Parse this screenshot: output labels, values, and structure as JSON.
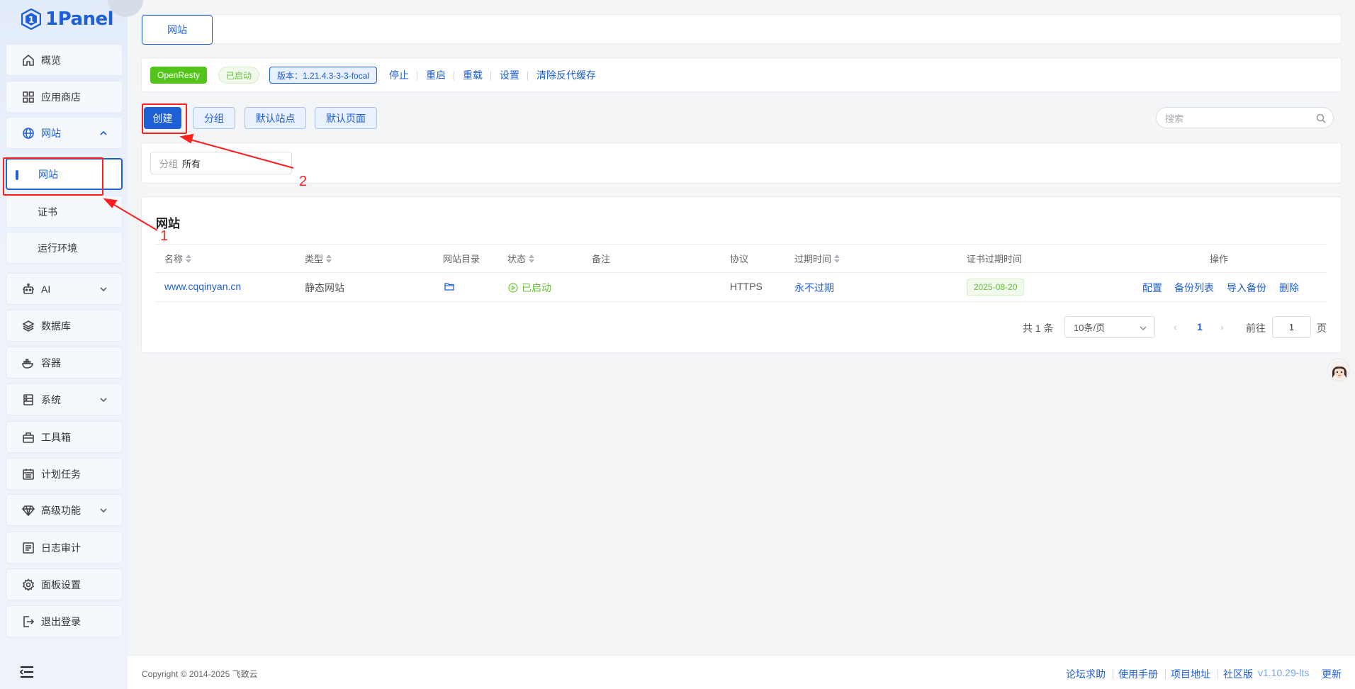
{
  "brand": {
    "name": "1Panel"
  },
  "sidebar": {
    "items": [
      {
        "label": "概览",
        "icon": "home-icon"
      },
      {
        "label": "应用商店",
        "icon": "grid-icon"
      },
      {
        "label": "网站",
        "icon": "globe-icon",
        "expanded": true
      },
      {
        "label": "AI",
        "icon": "robot-icon"
      },
      {
        "label": "数据库",
        "icon": "layers-icon"
      },
      {
        "label": "容器",
        "icon": "docker-icon"
      },
      {
        "label": "系统",
        "icon": "server-icon"
      },
      {
        "label": "工具箱",
        "icon": "toolbox-icon"
      },
      {
        "label": "计划任务",
        "icon": "calendar-icon"
      },
      {
        "label": "高级功能",
        "icon": "diamond-icon"
      },
      {
        "label": "日志审计",
        "icon": "log-icon"
      },
      {
        "label": "面板设置",
        "icon": "gear-icon"
      },
      {
        "label": "退出登录",
        "icon": "logout-icon"
      }
    ],
    "sub_items": [
      {
        "label": "网站",
        "active": true
      },
      {
        "label": "证书"
      },
      {
        "label": "运行环境"
      }
    ]
  },
  "header": {
    "tab": "网站"
  },
  "openresty": {
    "name": "OpenResty",
    "status": "已启动",
    "version": "版本：1.21.4.3-3-3-focal",
    "actions": [
      "停止",
      "重启",
      "重载",
      "设置",
      "清除反代缓存"
    ]
  },
  "toolbar": {
    "create": "创建",
    "group": "分组",
    "default_site": "默认站点",
    "default_page": "默认页面",
    "search_placeholder": "搜索"
  },
  "filter": {
    "label": "分组",
    "value": "所有"
  },
  "table": {
    "title": "网站",
    "columns": [
      "名称",
      "类型",
      "网站目录",
      "状态",
      "备注",
      "协议",
      "过期时间",
      "证书过期时间",
      "操作"
    ],
    "rows": [
      {
        "name": "www.cqqinyan.cn",
        "type": "静态网站",
        "status": "已启动",
        "remark": "",
        "protocol": "HTTPS",
        "expire": "永不过期",
        "cert_expire": "2025-08-20",
        "actions": [
          "配置",
          "备份列表",
          "导入备份",
          "删除"
        ]
      }
    ]
  },
  "pagination": {
    "total": "共 1 条",
    "page_size": "10条/页",
    "current": "1",
    "goto_label": "前往",
    "goto_value": "1",
    "page_suffix": "页"
  },
  "footer": {
    "copyright": "Copyright © 2014-2025 飞致云",
    "links": [
      "论坛求助",
      "使用手册",
      "项目地址",
      "社区版",
      "v1.10.29-lts",
      "更新"
    ]
  },
  "annotations": [
    "1",
    "2"
  ],
  "colors": {
    "primary": "#1f5fd6",
    "success": "#52c41a",
    "annotation": "#ff1f1f"
  }
}
